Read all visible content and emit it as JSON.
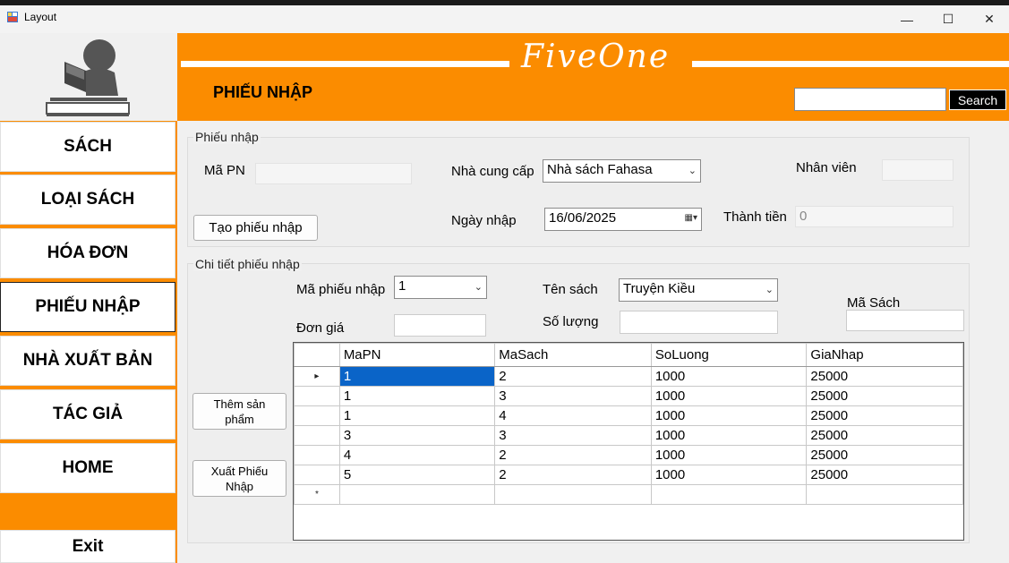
{
  "window": {
    "title": "Layout",
    "minimize": "—",
    "maximize": "☐",
    "close": "✕"
  },
  "header": {
    "brand": "FiveOne",
    "page_title": "PHIẾU NHẬP",
    "search_value": "",
    "search_label": "Search"
  },
  "sidebar": {
    "items": [
      {
        "label": "SÁCH"
      },
      {
        "label": "LOẠI SÁCH"
      },
      {
        "label": "HÓA ĐƠN"
      },
      {
        "label": "PHIẾU NHẬP"
      },
      {
        "label": "NHÀ XUẤT BẢN"
      },
      {
        "label": "TÁC GIẢ"
      },
      {
        "label": "HOME"
      },
      {
        "label": "Exit"
      }
    ],
    "active": "PHIẾU NHẬP"
  },
  "receipt": {
    "group_label": "Phiếu nhập",
    "ma_pn_label": "Mã PN",
    "ma_pn_value": "",
    "supplier_label": "Nhà cung cấp",
    "supplier_value": "Nhà sách Fahasa",
    "employee_label": "Nhân viên",
    "employee_value": "",
    "create_button": "Tạo phiếu nhập",
    "date_label": "Ngày nhập",
    "date_value": "16/06/2025",
    "total_label": "Thành tiền",
    "total_value": "0"
  },
  "detail": {
    "group_label": "Chi tiết phiếu nhập",
    "receipt_id_label": "Mã phiếu nhập",
    "receipt_id_value": "1",
    "book_name_label": "Tên sách",
    "book_name_value": "Truyện Kiều",
    "book_id_label": "Mã Sách",
    "book_id_value": "",
    "price_label": "Đơn giá",
    "price_value": "",
    "quantity_label": "Số lượng",
    "quantity_value": "",
    "add_button": "Thêm sản phẩm",
    "export_button": "Xuất Phiếu Nhập"
  },
  "grid": {
    "columns": [
      "MaPN",
      "MaSach",
      "SoLuong",
      "GiaNhap"
    ],
    "rows": [
      [
        "1",
        "2",
        "1000",
        "25000"
      ],
      [
        "1",
        "3",
        "1000",
        "25000"
      ],
      [
        "1",
        "4",
        "1000",
        "25000"
      ],
      [
        "3",
        "3",
        "1000",
        "25000"
      ],
      [
        "4",
        "2",
        "1000",
        "25000"
      ],
      [
        "5",
        "2",
        "1000",
        "25000"
      ]
    ],
    "current_row_marker": "▸",
    "new_row_marker": "*"
  },
  "colors": {
    "accent": "#fb8c00",
    "selection": "#0a64c8"
  }
}
